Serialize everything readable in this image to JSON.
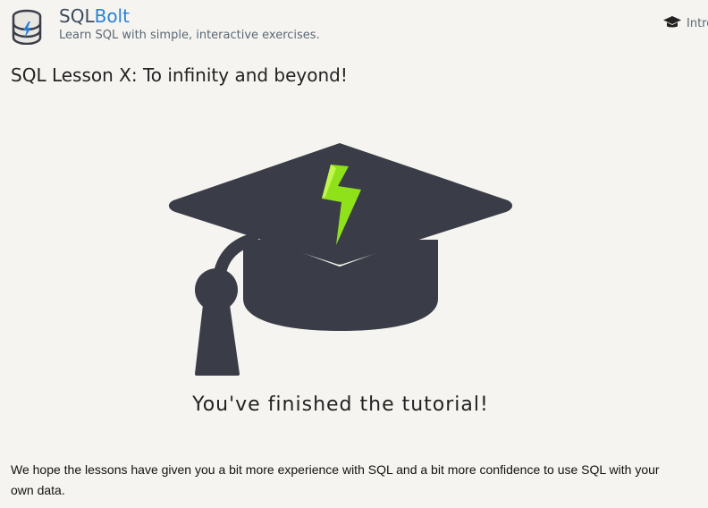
{
  "header": {
    "brand_sql": "SQL",
    "brand_bolt": "Bolt",
    "tagline": "Learn SQL with simple, interactive exercises.",
    "nav_label": "Introduction",
    "nav_icon": "graduation-cap-icon",
    "logo_icon": "database-bolt-icon"
  },
  "lesson": {
    "title": "SQL Lesson X: To infinity and beyond!",
    "illustration_icon": "graduation-cap-bolt-icon",
    "finished_text": "You've finished the tutorial!",
    "paragraph": "We hope the lessons have given you a bit more experience with SQL and a bit more confidence to use SQL with your own data."
  },
  "colors": {
    "background": "#f5f4f0",
    "brand_accent": "#2a7fd8",
    "cap_color": "#3a3d47",
    "bolt_color": "#8fe21a"
  }
}
